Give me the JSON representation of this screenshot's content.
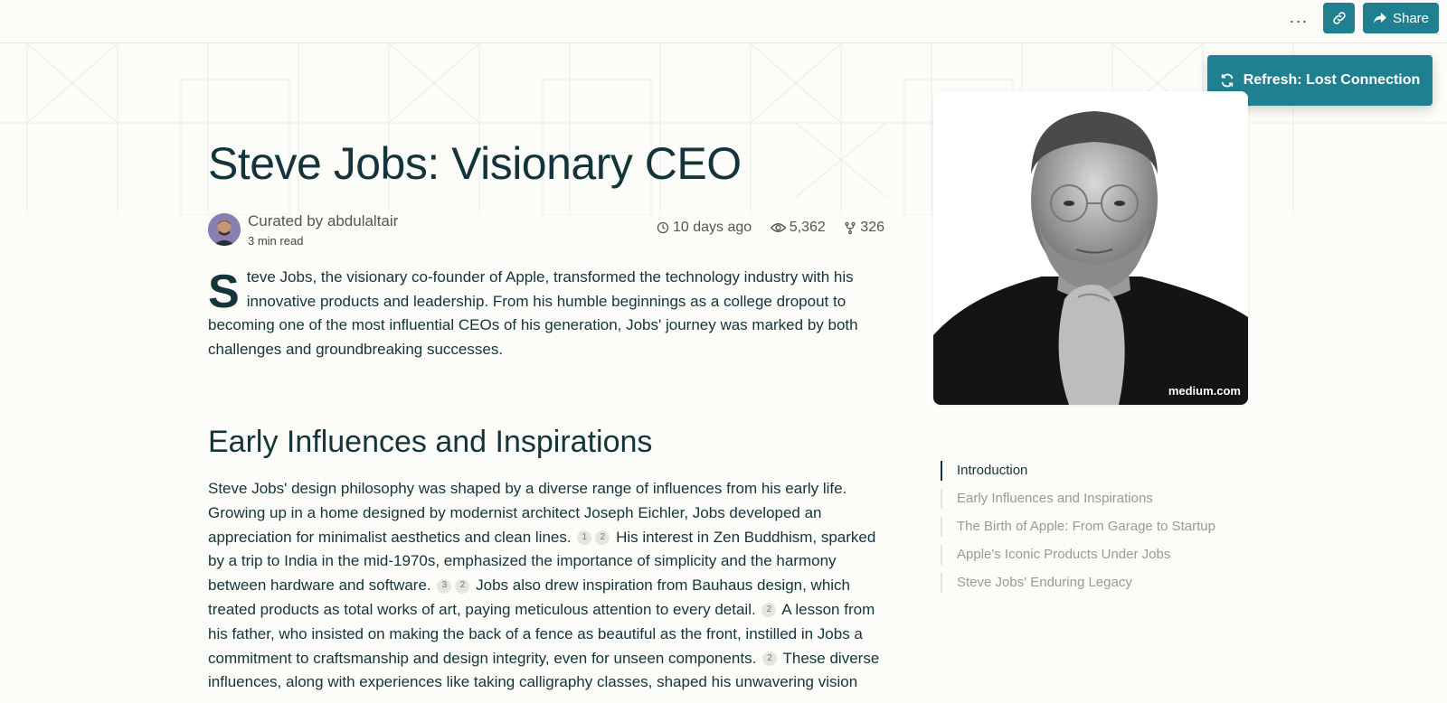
{
  "topbar": {
    "more_label": "···",
    "share_label": "Share"
  },
  "toast": {
    "label": "Refresh: Lost Connection"
  },
  "article": {
    "title": "Steve Jobs: Visionary CEO",
    "curated_by": "Curated by abdulaltair",
    "read_time": "3 min read",
    "stats": {
      "time_ago": "10 days ago",
      "views": "5,362",
      "forks": "326"
    },
    "dropcap": "S",
    "intro": "teve Jobs, the visionary co-founder of Apple, transformed the technology industry with his innovative products and leadership. From his humble beginnings as a college dropout to becoming one of the most influential CEOs of his generation, Jobs' journey was marked by both challenges and groundbreaking successes.",
    "section_heading": "Early Influences and Inspirations",
    "section_body": [
      {
        "text": "Steve Jobs' design philosophy was shaped by a diverse range of influences from his early life. Growing up in a home designed by modernist architect Joseph Eichler, Jobs developed an appreciation for minimalist aesthetics and clean lines.",
        "cites": [
          "1",
          "2"
        ]
      },
      {
        "text": "His interest in Zen Buddhism, sparked by a trip to India in the mid-1970s, emphasized the importance of simplicity and the harmony between hardware and software.",
        "cites": [
          "3",
          "2"
        ]
      },
      {
        "text": "Jobs also drew inspiration from Bauhaus design, which treated products as total works of art, paying meticulous attention to every detail.",
        "cites": [
          "2"
        ]
      },
      {
        "text": "A lesson from his father, who insisted on making the back of a fence as beautiful as the front, instilled in Jobs a commitment to craftsmanship and design integrity, even for unseen components.",
        "cites": [
          "2"
        ]
      },
      {
        "text": "These diverse influences, along with experiences like taking calligraphy classes, shaped his unwavering vision",
        "cites": []
      }
    ]
  },
  "photo": {
    "caption": "medium.com"
  },
  "toc": [
    {
      "label": "Introduction",
      "active": true
    },
    {
      "label": "Early Influences and Inspirations",
      "active": false
    },
    {
      "label": "The Birth of Apple: From Garage to Startup",
      "active": false
    },
    {
      "label": "Apple's Iconic Products Under Jobs",
      "active": false
    },
    {
      "label": "Steve Jobs' Enduring Legacy",
      "active": false
    }
  ],
  "colors": {
    "accent": "#218090",
    "text": "#13343b",
    "background": "#fcfcf9"
  }
}
